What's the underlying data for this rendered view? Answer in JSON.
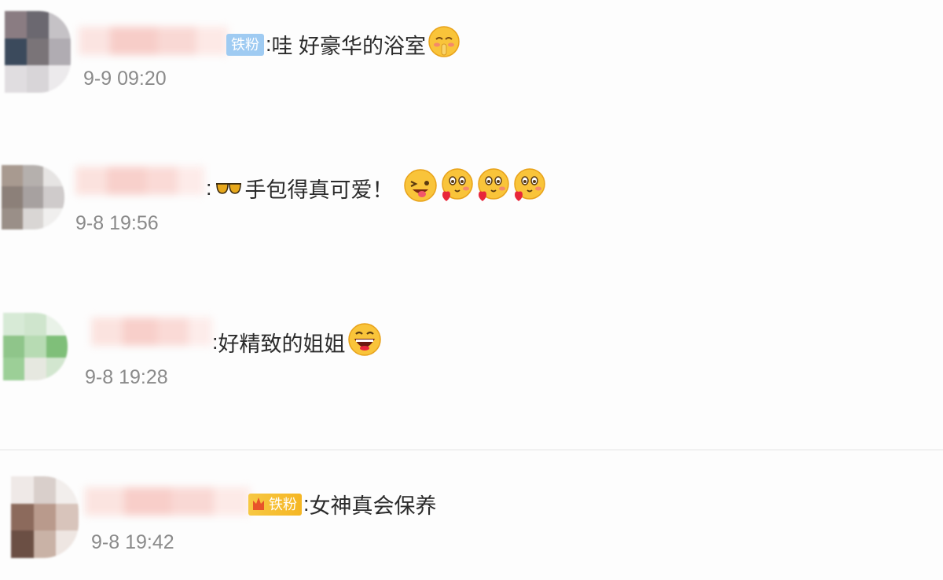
{
  "comments": [
    {
      "badge": "铁粉",
      "badge_style": "blue",
      "separator": ":",
      "text": "哇 好豪华的浴室",
      "emojis": [
        "shy-finger-emoji"
      ],
      "time": "9-9 09:20"
    },
    {
      "badge": "",
      "separator": ":",
      "prefix_icon": "sunglasses-icon",
      "text": "手包得真可爱！",
      "emojis": [
        "wink-tongue-emoji",
        "heart-hug-emoji",
        "heart-hug-emoji",
        "heart-hug-emoji"
      ],
      "time": "9-8 19:56"
    },
    {
      "badge": "",
      "separator": ":",
      "text": "好精致的姐姐",
      "emojis": [
        "big-laugh-emoji"
      ],
      "time": "9-8 19:28"
    },
    {
      "badge": "铁粉",
      "badge_style": "gold",
      "separator": ":",
      "text": "女神真会保养",
      "emojis": [],
      "time": "9-8 19:42"
    }
  ],
  "colors": {
    "text": "#2b2b2b",
    "time": "#8a8a8a",
    "badge_blue": "#9fcbf2",
    "badge_gold": "#f5b623",
    "name_blur": "#f7c9c4"
  }
}
